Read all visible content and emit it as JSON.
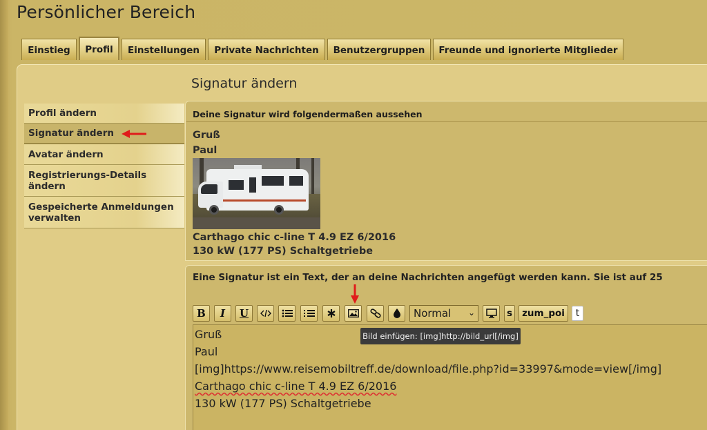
{
  "page": {
    "title": "Persönlicher Bereich"
  },
  "tabs": [
    {
      "label": "Einstieg"
    },
    {
      "label": "Profil",
      "active": true
    },
    {
      "label": "Einstellungen"
    },
    {
      "label": "Private Nachrichten"
    },
    {
      "label": "Benutzergruppen"
    },
    {
      "label": "Freunde und ignorierte Mitglieder"
    }
  ],
  "panel": {
    "title": "Signatur ändern"
  },
  "sidebar": {
    "items": [
      {
        "label": "Profil ändern"
      },
      {
        "label": "Signatur ändern",
        "active": true
      },
      {
        "label": "Avatar ändern"
      },
      {
        "label": "Registrierungs-Details ändern"
      },
      {
        "label": "Gespeicherte Anmeldungen verwalten"
      }
    ]
  },
  "preview": {
    "header": "Deine Signatur wird folgendermaßen aussehen",
    "line1": "Gruß",
    "line2": "Paul",
    "line3": "Carthago chic c-line T 4.9 EZ 6/2016",
    "line4": "130 kW (177 PS) Schaltgetriebe"
  },
  "editor": {
    "intro": "Eine Signatur ist ein Text, der an deine Nachrichten angefügt werden kann. Sie ist auf 25",
    "toolbar": {
      "bold": "B",
      "italic": "I",
      "underline": "U",
      "font_size_value": "Normal",
      "s_label": "s",
      "zum_poi_label": "zum_poi",
      "t_label": "t"
    },
    "textarea_lines": [
      "Gruß",
      "Paul",
      "[img]https://www.reisemobiltreff.de/download/file.php?id=33997&mode=view[/img]",
      "Carthago chic c-line T 4.9 EZ 6/2016",
      "130 kW (177 PS) Schaltgetriebe"
    ],
    "tooltip": "Bild einfügen: [img]http://bild_url[/img]"
  },
  "colors": {
    "annotation_arrow": "#e01b1b"
  }
}
